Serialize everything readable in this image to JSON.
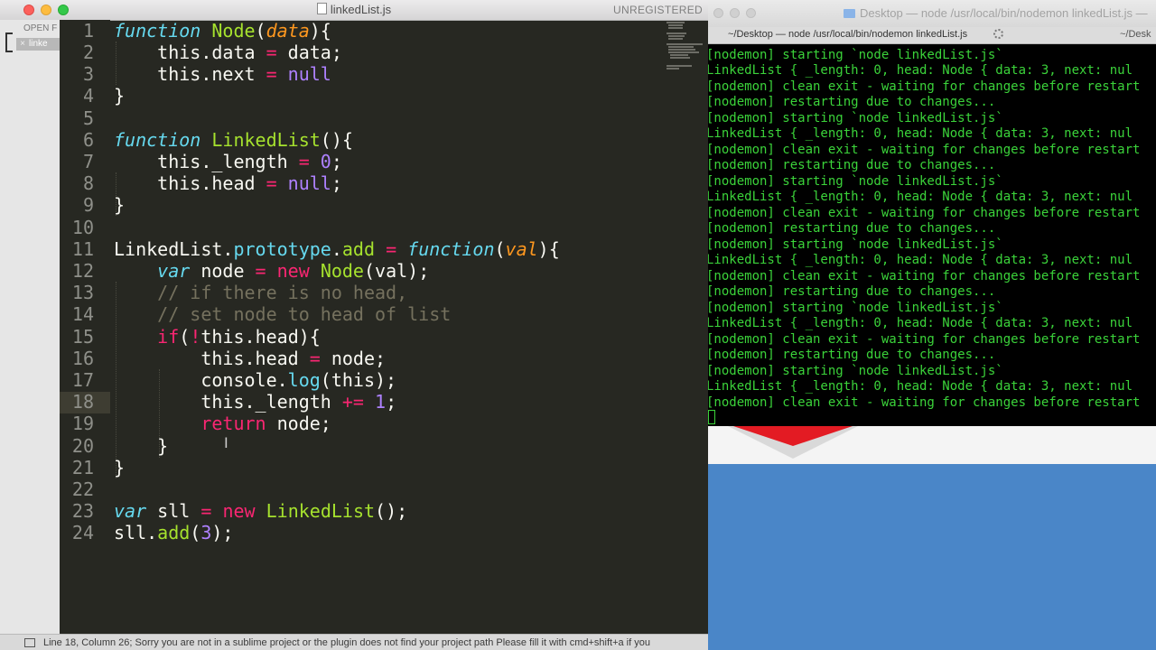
{
  "editor": {
    "title": "linkedList.js",
    "unregistered": "UNREGISTERED",
    "sidebar": {
      "open_files_label": "OPEN F",
      "file_item": "linke"
    },
    "status": "Line 18, Column 26; Sorry you are not in a sublime project or the plugin does not find your project path    Please fill it with cmd+shift+a if you",
    "line_numbers": [
      "1",
      "2",
      "3",
      "4",
      "5",
      "6",
      "7",
      "8",
      "9",
      "10",
      "11",
      "12",
      "13",
      "14",
      "15",
      "16",
      "17",
      "18",
      "19",
      "20",
      "21",
      "22",
      "23",
      "24"
    ],
    "active_line": "18"
  },
  "terminal": {
    "title": "Desktop — node /usr/local/bin/nodemon linkedList.js —",
    "tab_active": "~/Desktop — node /usr/local/bin/nodemon linkedList.js",
    "tab_other": "~/Desk",
    "lines": [
      "[nodemon] starting `node linkedList.js`",
      "LinkedList { _length: 0, head: Node { data: 3, next: nul",
      "[nodemon] clean exit - waiting for changes before restart",
      "[nodemon] restarting due to changes...",
      "[nodemon] starting `node linkedList.js`",
      "LinkedList { _length: 0, head: Node { data: 3, next: nul",
      "[nodemon] clean exit - waiting for changes before restart",
      "[nodemon] restarting due to changes...",
      "[nodemon] starting `node linkedList.js`",
      "LinkedList { _length: 0, head: Node { data: 3, next: nul",
      "[nodemon] clean exit - waiting for changes before restart",
      "[nodemon] restarting due to changes...",
      "[nodemon] starting `node linkedList.js`",
      "LinkedList { _length: 0, head: Node { data: 3, next: nul",
      "[nodemon] clean exit - waiting for changes before restart",
      "[nodemon] restarting due to changes...",
      "[nodemon] starting `node linkedList.js`",
      "LinkedList { _length: 0, head: Node { data: 3, next: nul",
      "[nodemon] clean exit - waiting for changes before restart",
      "[nodemon] restarting due to changes...",
      "[nodemon] starting `node linkedList.js`",
      "LinkedList { _length: 0, head: Node { data: 3, next: nul",
      "[nodemon] clean exit - waiting for changes before restart"
    ]
  },
  "code": {
    "l1": {
      "a": "function",
      "b": " ",
      "c": "Node",
      "d": "(",
      "e": "data",
      "f": "){"
    },
    "l2": {
      "a": "    this.data ",
      "b": "=",
      "c": " data;"
    },
    "l3": {
      "a": "    this.next ",
      "b": "=",
      "c": " ",
      "d": "null"
    },
    "l4": {
      "a": "}"
    },
    "l6": {
      "a": "function",
      "b": " ",
      "c": "LinkedList",
      "d": "(){"
    },
    "l7": {
      "a": "    this._length ",
      "b": "=",
      "c": " ",
      "d": "0",
      "e": ";"
    },
    "l8": {
      "a": "    this.head ",
      "b": "=",
      "c": " ",
      "d": "null",
      "e": ";"
    },
    "l9": {
      "a": "}"
    },
    "l11": {
      "a": "LinkedList",
      "b": ".",
      "c": "prototype",
      "d": ".",
      "e": "add",
      "f": " ",
      "g": "=",
      "h": " ",
      "i": "function",
      "j": "(",
      "k": "val",
      "l": "){"
    },
    "l12": {
      "a": "    ",
      "b": "var",
      "c": " node ",
      "d": "=",
      "e": " ",
      "f": "new",
      "g": " ",
      "h": "Node",
      "i": "(val);"
    },
    "l13": {
      "a": "    // if there is no head,"
    },
    "l14": {
      "a": "    // set node to head of list"
    },
    "l15": {
      "a": "    ",
      "b": "if",
      "c": "(",
      "d": "!",
      "e": "this.head){"
    },
    "l16": {
      "a": "        this.head ",
      "b": "=",
      "c": " node;"
    },
    "l17": {
      "a": "        console.",
      "b": "log",
      "c": "(this);"
    },
    "l18": {
      "a": "        this._length ",
      "b": "+=",
      "c": " ",
      "d": "1",
      "e": ";"
    },
    "l19": {
      "a": "        ",
      "b": "return",
      "c": " node;"
    },
    "l20": {
      "a": "    }"
    },
    "l21": {
      "a": "}"
    },
    "l23": {
      "a": "var",
      "b": " sll ",
      "c": "=",
      "d": " ",
      "e": "new",
      "f": " ",
      "g": "LinkedList",
      "h": "();"
    },
    "l24": {
      "a": "sll.",
      "b": "add",
      "c": "(",
      "d": "3",
      "e": ");"
    }
  },
  "colors": {
    "editor_bg": "#272822",
    "keyword": "#66d9ef",
    "function_name": "#a6e22e",
    "param": "#fd971f",
    "operator": "#f92672",
    "number": "#ae81ff",
    "comment": "#75715e",
    "terminal_text": "#3bd33a"
  }
}
